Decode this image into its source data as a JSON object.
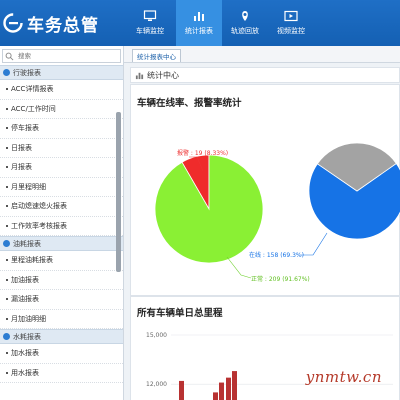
{
  "app": {
    "title": "车务总管"
  },
  "nav": [
    {
      "label": "车辆监控",
      "icon": "monitor-icon"
    },
    {
      "label": "统计报表",
      "icon": "bar-chart-icon",
      "active": true
    },
    {
      "label": "轨迹回放",
      "icon": "location-pin-icon"
    },
    {
      "label": "视频监控",
      "icon": "video-icon"
    }
  ],
  "sidebar": {
    "search_placeholder": "搜索",
    "groups": [
      {
        "label": "行驶报表",
        "items": [
          "ACC详情报表",
          "ACC/工作时间",
          "停车报表",
          "日报表",
          "月报表",
          "月里程明细",
          "启动熄速熄火报表",
          "工作效率考核报表"
        ]
      },
      {
        "label": "油耗报表",
        "items": [
          "里程油耗报表",
          "加油报表",
          "漏油报表",
          "月加油明细"
        ]
      },
      {
        "label": "水耗报表",
        "items": [
          "加水报表",
          "用水报表"
        ]
      }
    ]
  },
  "main": {
    "tab_label": "统计报表中心",
    "header": "统计中心",
    "card1_title": "车辆在线率、报警率统计",
    "card2_title": "所有车辆单日总里程"
  },
  "chart_data": [
    {
      "type": "pie",
      "title": "车辆在线率、报警率统计",
      "slices": [
        {
          "label": "报警 : 19 (8.33%)",
          "value": 19,
          "color": "#ef2b2b"
        },
        {
          "label": "正常 : 209 (91.67%)",
          "value": 209,
          "color": "#8af034"
        }
      ]
    },
    {
      "type": "pie",
      "slices": [
        {
          "label": "在线 : 158 (69.3%)",
          "value": 158,
          "color": "#1673e6"
        },
        {
          "label": "",
          "value": 70,
          "color": "#a3a3a3"
        }
      ]
    },
    {
      "type": "bar",
      "title": "所有车辆单日总里程",
      "ylim": [
        10000,
        15000
      ],
      "yticks": [
        "15,000",
        "12,000"
      ],
      "values": [
        12200,
        11500,
        12100,
        12400,
        12800,
        13200
      ],
      "color": "#b83232"
    }
  ],
  "watermark": "ynmtw.cn"
}
